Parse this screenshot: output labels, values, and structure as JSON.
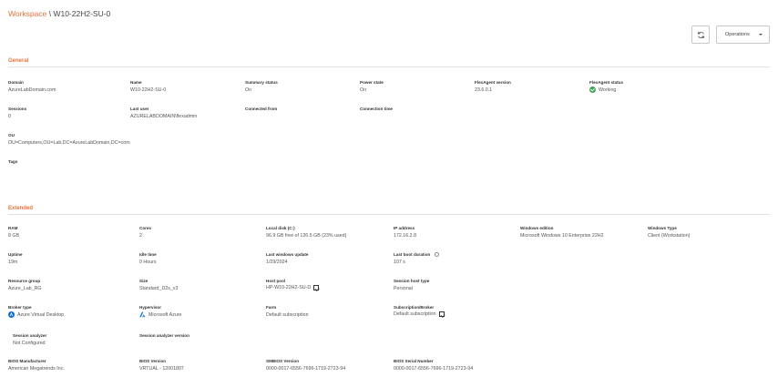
{
  "header": {
    "breadcrumb_link": "Workspace",
    "breadcrumb_sep": " \\ ",
    "breadcrumb_current": "W10-22H2-SU-0",
    "operations_label": "Operations"
  },
  "general": {
    "title": "General",
    "domain": {
      "label": "Domain",
      "value": "AzureLabDomain.com"
    },
    "name": {
      "label": "Name",
      "value": "W10-22H2-SU-0"
    },
    "summary_status": {
      "label": "Summary status",
      "value": "On"
    },
    "power_state": {
      "label": "Power state",
      "value": "On"
    },
    "flexagent_version": {
      "label": "FlexAgent version",
      "value": "23.6.0.1"
    },
    "flexagent_status": {
      "label": "FlexAgent status",
      "value": "Working"
    },
    "sessions": {
      "label": "Sessions",
      "value": "0"
    },
    "last_user": {
      "label": "Last user",
      "value": "AZURELABDOMAIN\\flexadmin"
    },
    "connected_from": {
      "label": "Connected from",
      "value": ""
    },
    "connection_time": {
      "label": "Connection time",
      "value": ""
    },
    "ou": {
      "label": "OU",
      "value": "OU=Computers,OU=Lab,DC=AzureLabDomain,DC=com"
    },
    "tags": {
      "label": "Tags",
      "value": ""
    }
  },
  "extended": {
    "title": "Extended",
    "ram": {
      "label": "RAM",
      "value": "8 GB"
    },
    "cores": {
      "label": "Cores",
      "value": "2"
    },
    "local_disk": {
      "label": "Local disk (C:)",
      "value": "96.9 GB free of 126.5 GB (23% used)"
    },
    "ip_address": {
      "label": "IP address",
      "value": "172.16.2.8"
    },
    "windows_edition": {
      "label": "Windows edition",
      "value": "Microsoft Windows 10 Enterprise 22H2"
    },
    "windows_type": {
      "label": "Windows Type",
      "value": "Client (Workstation)"
    },
    "uptime": {
      "label": "Uptime",
      "value": "19m"
    },
    "idle_time": {
      "label": "Idle time",
      "value": "0 Hours"
    },
    "last_windows_update": {
      "label": "Last windows update",
      "value": "1/29/2024"
    },
    "last_boot_duration": {
      "label": "Last boot duration",
      "value": "107 s"
    },
    "resource_group": {
      "label": "Resource group",
      "value": "Azure_Lab_RG"
    },
    "size": {
      "label": "Size",
      "value": "Standard_D2s_v3"
    },
    "host_pool": {
      "label": "Host pool",
      "value": "HP-W10-22H2-SU-D"
    },
    "session_host_type": {
      "label": "Session host type",
      "value": "Personal"
    },
    "broker_type": {
      "label": "Broker type",
      "value": "Azure Virtual Desktop"
    },
    "hypervisor": {
      "label": "Hypervisor",
      "value": "Microsoft Azure"
    },
    "farm": {
      "label": "Farm",
      "value": "Default subscription"
    },
    "subscription_broker": {
      "label": "Subscription/Broker",
      "value": "Default subscription"
    },
    "session_analyzer": {
      "label": "Session analyzer",
      "value": "Not Configured"
    },
    "session_analyzer_version": {
      "label": "Session analyzer version",
      "value": ""
    },
    "bios_manufacturer": {
      "label": "BIOS Manufacturer",
      "value": "American Megatrends Inc."
    },
    "bios_version": {
      "label": "BIOS Version",
      "value": "VRTUAL - 12001807"
    },
    "smbios_version": {
      "label": "SMBIOS Version",
      "value": "0000-0017-6556-7696-1719-2723-94"
    },
    "bios_serial_number": {
      "label": "BIOS Serial Number",
      "value": "0000-0017-6556-7696-1719-2723-94"
    }
  },
  "colors": {
    "accent": "#e8733a",
    "status_ok": "#3aa655",
    "azure": "#0a6ed1"
  },
  "icons": [
    "refresh-icon",
    "chevron-down-icon",
    "check-circle-icon",
    "info-icon",
    "edit-icon",
    "azure-virtual-desktop-icon",
    "microsoft-azure-icon"
  ]
}
